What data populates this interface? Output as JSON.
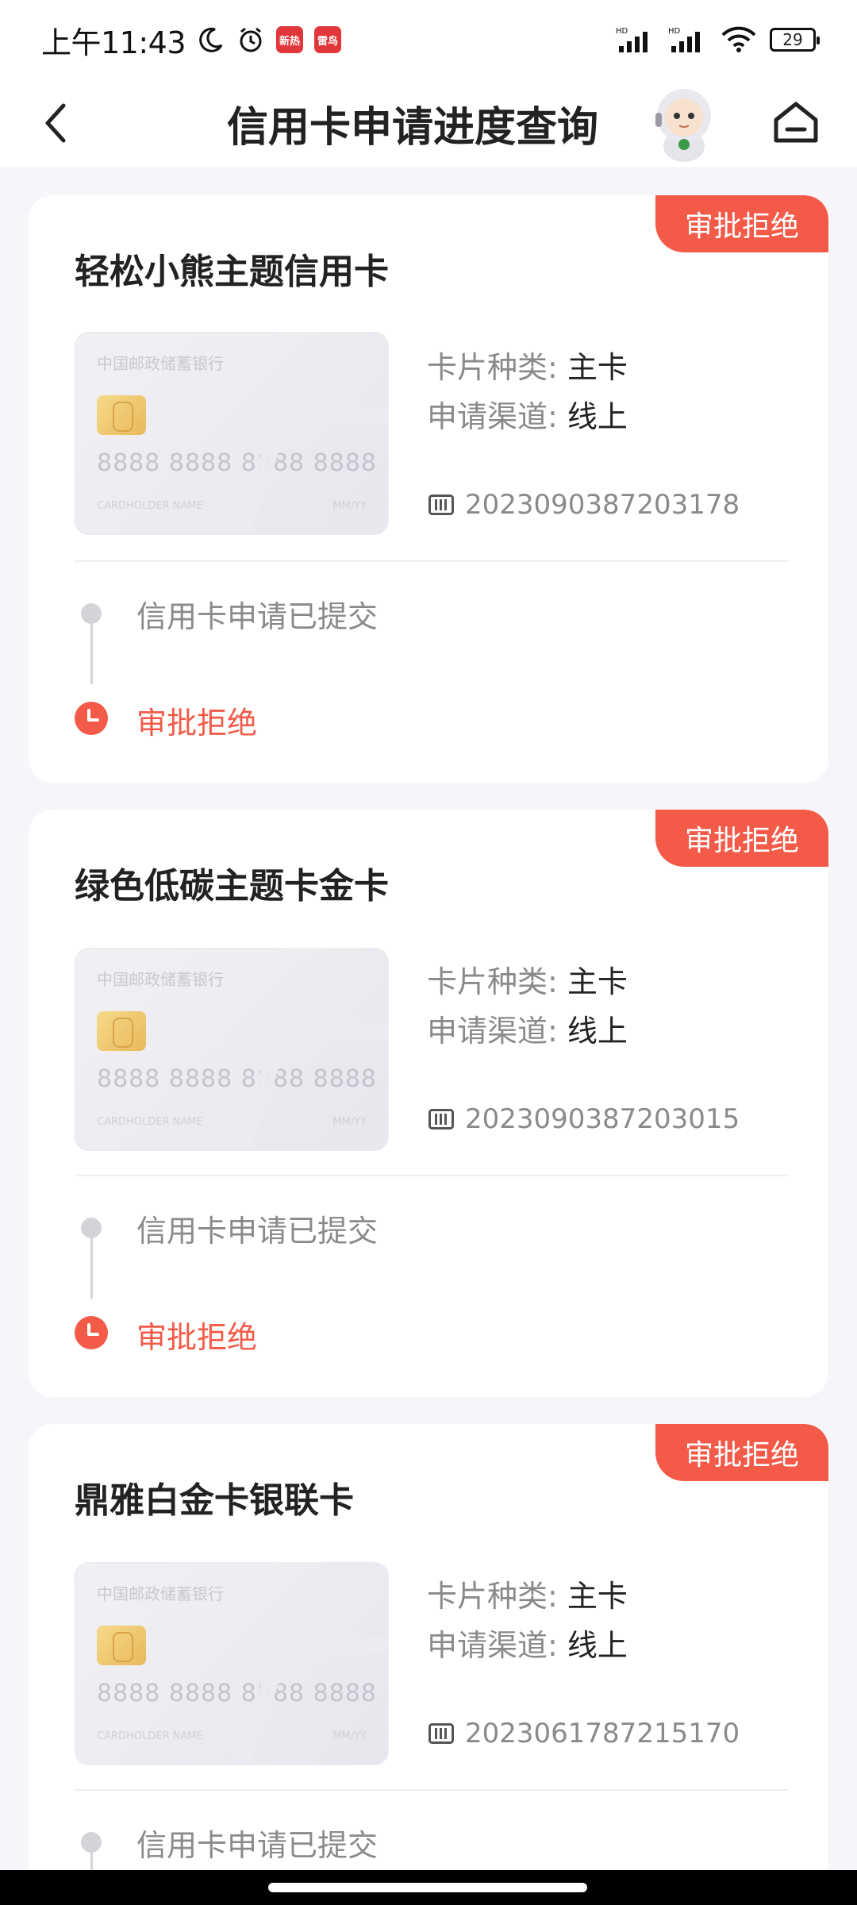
{
  "status_bar": {
    "time": "上午11:43",
    "app_badge_1": "新热",
    "app_badge_2": "雷鸟",
    "battery": "29",
    "signal_label_1": "HD",
    "signal_label_2": "HD"
  },
  "header": {
    "title": "信用卡申请进度查询"
  },
  "cards": [
    {
      "status": "审批拒绝",
      "title": "轻松小熊主题信用卡",
      "card_image": {
        "bank": "中国邮政储蓄银行",
        "number": "8888 8888 8888 8888",
        "holder": "CARDHOLDER NAME",
        "date": "MM/YY"
      },
      "card_type_label": "卡片种类:",
      "card_type_value": "主卡",
      "channel_label": "申请渠道:",
      "channel_value": "线上",
      "serial": "2023090387203178",
      "step_submitted": "信用卡申请已提交",
      "step_result": "审批拒绝"
    },
    {
      "status": "审批拒绝",
      "title": "绿色低碳主题卡金卡",
      "card_image": {
        "bank": "中国邮政储蓄银行",
        "number": "8888 8888 8888 8888",
        "holder": "CARDHOLDER NAME",
        "date": "MM/YY"
      },
      "card_type_label": "卡片种类:",
      "card_type_value": "主卡",
      "channel_label": "申请渠道:",
      "channel_value": "线上",
      "serial": "2023090387203015",
      "step_submitted": "信用卡申请已提交",
      "step_result": "审批拒绝"
    },
    {
      "status": "审批拒绝",
      "title": "鼎雅白金卡银联卡",
      "card_image": {
        "bank": "中国邮政储蓄银行",
        "number": "8888 8888 8888 8888",
        "holder": "CARDHOLDER NAME",
        "date": "MM/YY"
      },
      "card_type_label": "卡片种类:",
      "card_type_value": "主卡",
      "channel_label": "申请渠道:",
      "channel_value": "线上",
      "serial": "2023061787215170",
      "step_submitted": "信用卡申请已提交"
    }
  ],
  "colors": {
    "accent_red": "#f35a48",
    "background": "#f5f5fa"
  }
}
